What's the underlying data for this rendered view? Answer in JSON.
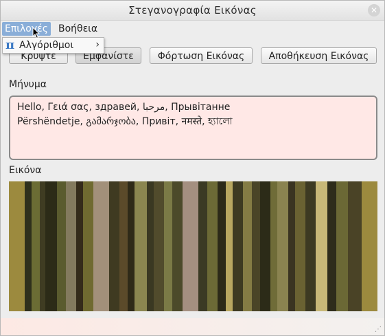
{
  "window": {
    "title": "Στεγανογραφία Εικόνας"
  },
  "menubar": {
    "options": "Επιλογές",
    "help": "Βοήθεια"
  },
  "dropdown": {
    "icon": "pi-icon",
    "icon_glyph": "π",
    "item": "Αλγόριθμοι",
    "arrow": "›"
  },
  "toolbar": {
    "hide_label": "Κρύψτε",
    "show_label": "Εμφανίστε",
    "load_label": "Φόρτωση Εικόνας",
    "save_label": "Αποθήκευση Εικόνας"
  },
  "message": {
    "label": "Μήνυμα",
    "line1": "Hello, Γειά σας, здравей, مرحبا, Прывітанне",
    "line2": "Përshëndetje, გამარჯობა, Привіт, नमस्ते, হ্যালো"
  },
  "image": {
    "label": "Εικόνα",
    "stripes": [
      {
        "c": "#9c8a3e",
        "w": 18
      },
      {
        "c": "#2f301c",
        "w": 8
      },
      {
        "c": "#6b6c34",
        "w": 10
      },
      {
        "c": "#3f3c22",
        "w": 6
      },
      {
        "c": "#2c2b17",
        "w": 14
      },
      {
        "c": "#5a5b2e",
        "w": 10
      },
      {
        "c": "#837a5e",
        "w": 12
      },
      {
        "c": "#342b1a",
        "w": 8
      },
      {
        "c": "#6f6a30",
        "w": 12
      },
      {
        "c": "#a2907a",
        "w": 18
      },
      {
        "c": "#3f3a21",
        "w": 12
      },
      {
        "c": "#5b4a2a",
        "w": 10
      },
      {
        "c": "#2f2a18",
        "w": 8
      },
      {
        "c": "#8b8650",
        "w": 14
      },
      {
        "c": "#3a3822",
        "w": 8
      },
      {
        "c": "#514b2c",
        "w": 12
      },
      {
        "c": "#7b7a46",
        "w": 10
      },
      {
        "c": "#4c4a2a",
        "w": 12
      },
      {
        "c": "#a48f80",
        "w": 18
      },
      {
        "c": "#3b3a24",
        "w": 10
      },
      {
        "c": "#6c6a36",
        "w": 12
      },
      {
        "c": "#2c2a18",
        "w": 10
      },
      {
        "c": "#b8a760",
        "w": 8
      },
      {
        "c": "#3d3a21",
        "w": 12
      },
      {
        "c": "#847c44",
        "w": 10
      },
      {
        "c": "#4a4527",
        "w": 10
      },
      {
        "c": "#2c2b18",
        "w": 12
      },
      {
        "c": "#6f6c38",
        "w": 8
      },
      {
        "c": "#8a8350",
        "w": 12
      },
      {
        "c": "#3a3421",
        "w": 8
      },
      {
        "c": "#6a6232",
        "w": 12
      },
      {
        "c": "#3d3a22",
        "w": 12
      },
      {
        "c": "#c8b878",
        "w": 14
      },
      {
        "c": "#2e2c1b",
        "w": 10
      },
      {
        "c": "#6b6835",
        "w": 14
      },
      {
        "c": "#4a4326",
        "w": 16
      },
      {
        "c": "#9c8a3e",
        "w": 18
      }
    ]
  },
  "statusbar": {
    "grip": "⋰"
  }
}
